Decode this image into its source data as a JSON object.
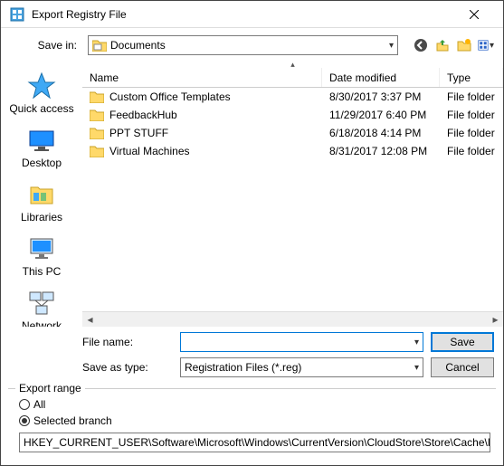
{
  "title": "Export Registry File",
  "savein": {
    "label": "Save in:",
    "value": "Documents"
  },
  "toolbar_icons": [
    "back-icon",
    "up-icon",
    "new-folder-icon",
    "views-icon"
  ],
  "places": [
    {
      "key": "quick-access",
      "label": "Quick access"
    },
    {
      "key": "desktop",
      "label": "Desktop"
    },
    {
      "key": "libraries",
      "label": "Libraries"
    },
    {
      "key": "this-pc",
      "label": "This PC"
    },
    {
      "key": "network",
      "label": "Network"
    }
  ],
  "columns": {
    "name": "Name",
    "date": "Date modified",
    "type": "Type"
  },
  "rows": [
    {
      "name": "Custom Office Templates",
      "date": "8/30/2017 3:37 PM",
      "type": "File folder"
    },
    {
      "name": "FeedbackHub",
      "date": "11/29/2017 6:40 PM",
      "type": "File folder"
    },
    {
      "name": "PPT STUFF",
      "date": "6/18/2018 4:14 PM",
      "type": "File folder"
    },
    {
      "name": "Virtual Machines",
      "date": "8/31/2017 12:08 PM",
      "type": "File folder"
    }
  ],
  "filename": {
    "label": "File name:",
    "value": ""
  },
  "saveastype": {
    "label": "Save as type:",
    "value": "Registration Files (*.reg)"
  },
  "buttons": {
    "save": "Save",
    "cancel": "Cancel"
  },
  "export": {
    "legend": "Export range",
    "all": "All",
    "selected": "Selected branch",
    "path": "HKEY_CURRENT_USER\\Software\\Microsoft\\Windows\\CurrentVersion\\CloudStore\\Store\\Cache\\Def"
  }
}
